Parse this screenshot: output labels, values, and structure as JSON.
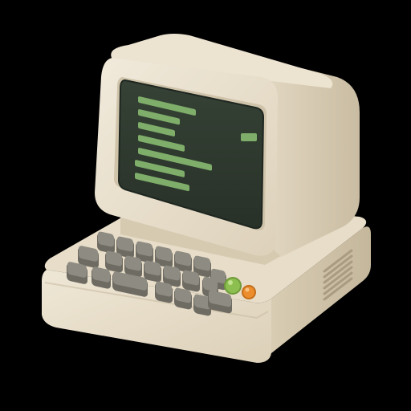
{
  "icon": {
    "name": "retro-computer-icon",
    "colors": {
      "background": "#000000",
      "body_light": "#efe7d6",
      "body_mid": "#e1d6c0",
      "body_shadow": "#c6b99f",
      "bezel": "#d9cdb5",
      "screen": "#2f3a30",
      "screen_edge": "#1e2620",
      "code_line": "#7fae6a",
      "key_top": "#8e8b82",
      "key_side": "#6e6b63",
      "green_button": "#8cbf4f",
      "orange_button": "#ec8d2e",
      "vent": "#b5a88e"
    },
    "screen_code_lines": 7,
    "keyboard_keys": 21,
    "vent_slots": 6
  }
}
